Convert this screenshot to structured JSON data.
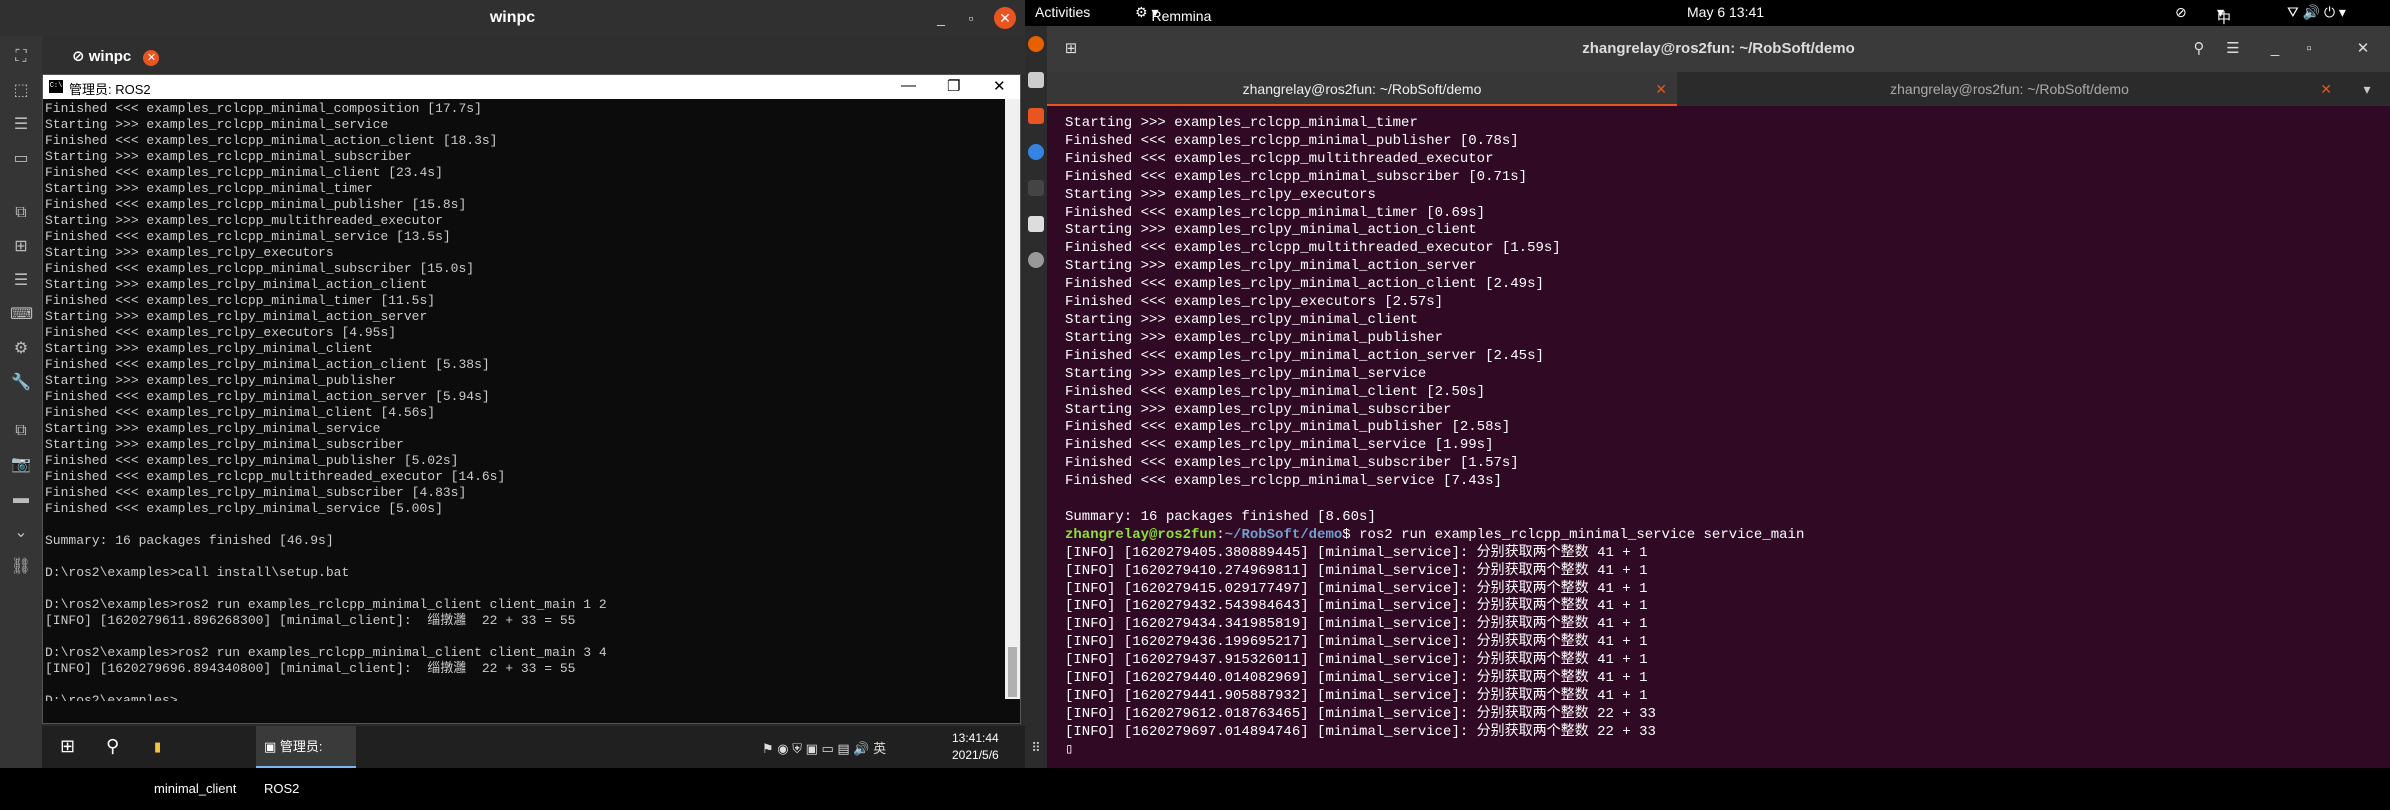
{
  "remmina": {
    "title": "winpc",
    "tab_label": "winpc",
    "tab_close": "✕"
  },
  "cmd": {
    "title": "管理员: ROS2",
    "icon_text": "C:\\",
    "lines": [
      "Finished <<< examples_rclcpp_minimal_composition [17.7s]",
      "Starting >>> examples_rclcpp_minimal_service",
      "Finished <<< examples_rclcpp_minimal_action_client [18.3s]",
      "Starting >>> examples_rclcpp_minimal_subscriber",
      "Finished <<< examples_rclcpp_minimal_client [23.4s]",
      "Starting >>> examples_rclcpp_minimal_timer",
      "Finished <<< examples_rclcpp_minimal_publisher [15.8s]",
      "Starting >>> examples_rclcpp_multithreaded_executor",
      "Finished <<< examples_rclcpp_minimal_service [13.5s]",
      "Starting >>> examples_rclpy_executors",
      "Finished <<< examples_rclcpp_minimal_subscriber [15.0s]",
      "Starting >>> examples_rclpy_minimal_action_client",
      "Finished <<< examples_rclcpp_minimal_timer [11.5s]",
      "Starting >>> examples_rclpy_minimal_action_server",
      "Finished <<< examples_rclpy_executors [4.95s]",
      "Starting >>> examples_rclpy_minimal_client",
      "Finished <<< examples_rclpy_minimal_action_client [5.38s]",
      "Starting >>> examples_rclpy_minimal_publisher",
      "Finished <<< examples_rclpy_minimal_action_server [5.94s]",
      "Finished <<< examples_rclpy_minimal_client [4.56s]",
      "Starting >>> examples_rclpy_minimal_service",
      "Starting >>> examples_rclpy_minimal_subscriber",
      "Finished <<< examples_rclpy_minimal_publisher [5.02s]",
      "Finished <<< examples_rclcpp_multithreaded_executor [14.6s]",
      "Finished <<< examples_rclpy_minimal_subscriber [4.83s]",
      "Finished <<< examples_rclpy_minimal_service [5.00s]",
      "",
      "Summary: 16 packages finished [46.9s]",
      "",
      "D:\\ros2\\examples>call install\\setup.bat",
      "",
      "D:\\ros2\\examples>ros2 run examples_rclcpp_minimal_client client_main 1 2",
      "[INFO] [1620279611.896268300] [minimal_client]:  缁撴灉  22 + 33 = 55",
      "",
      "D:\\ros2\\examples>ros2 run examples_rclcpp_minimal_client client_main 3 4",
      "[INFO] [1620279696.894340800] [minimal_client]:  缁撴灉  22 + 33 = 55",
      "",
      "D:\\ros2\\examples>_"
    ]
  },
  "taskbar": {
    "apps": [
      "minimal_client",
      "管理员: ROS2"
    ],
    "tray_lang": "英",
    "time": "13:41:44",
    "date": "2021/5/6"
  },
  "ubuntu_topbar": {
    "activities": "Activities",
    "app_menu": "Remmina",
    "clock": "May 6  13:41",
    "input_method": "中"
  },
  "terminal": {
    "title": "zhangrelay@ros2fun: ~/RobSoft/demo",
    "tabs": [
      "zhangrelay@ros2fun: ~/RobSoft/demo",
      "zhangrelay@ros2fun: ~/RobSoft/demo"
    ],
    "lines_before": [
      "Starting >>> examples_rclcpp_minimal_timer",
      "Finished <<< examples_rclcpp_minimal_publisher [0.78s]",
      "Finished <<< examples_rclcpp_multithreaded_executor",
      "Finished <<< examples_rclcpp_minimal_subscriber [0.71s]",
      "Starting >>> examples_rclpy_executors",
      "Finished <<< examples_rclcpp_minimal_timer [0.69s]",
      "Starting >>> examples_rclpy_minimal_action_client",
      "Finished <<< examples_rclcpp_multithreaded_executor [1.59s]",
      "Starting >>> examples_rclpy_minimal_action_server",
      "Finished <<< examples_rclpy_minimal_action_client [2.49s]",
      "Finished <<< examples_rclpy_executors [2.57s]",
      "Starting >>> examples_rclpy_minimal_client",
      "Starting >>> examples_rclpy_minimal_publisher",
      "Finished <<< examples_rclpy_minimal_action_server [2.45s]",
      "Starting >>> examples_rclpy_minimal_service",
      "Finished <<< examples_rclpy_minimal_client [2.50s]",
      "Starting >>> examples_rclpy_minimal_subscriber",
      "Finished <<< examples_rclpy_minimal_publisher [2.58s]",
      "Finished <<< examples_rclpy_minimal_service [1.99s]",
      "Finished <<< examples_rclpy_minimal_subscriber [1.57s]",
      "Finished <<< examples_rclcpp_minimal_service [7.43s]",
      "",
      "Summary: 16 packages finished [8.60s]"
    ],
    "prompt_user": "zhangrelay@ros2fun",
    "prompt_sep": ":",
    "prompt_path": "~/RobSoft/demo",
    "prompt_cmd": "$ ros2 run examples_rclcpp_minimal_service service_main",
    "lines_after": [
      "[INFO] [1620279405.380889445] [minimal_service]: 分别获取两个整数 41 + 1",
      "[INFO] [1620279410.274969811] [minimal_service]: 分别获取两个整数 41 + 1",
      "[INFO] [1620279415.029177497] [minimal_service]: 分别获取两个整数 41 + 1",
      "[INFO] [1620279432.543984643] [minimal_service]: 分别获取两个整数 41 + 1",
      "[INFO] [1620279434.341985819] [minimal_service]: 分别获取两个整数 41 + 1",
      "[INFO] [1620279436.199695217] [minimal_service]: 分别获取两个整数 41 + 1",
      "[INFO] [1620279437.915326011] [minimal_service]: 分别获取两个整数 41 + 1",
      "[INFO] [1620279440.014082969] [minimal_service]: 分别获取两个整数 41 + 1",
      "[INFO] [1620279441.905887932] [minimal_service]: 分别获取两个整数 41 + 1",
      "[INFO] [1620279612.018763465] [minimal_service]: 分别获取两个整数 22 + 33",
      "[INFO] [1620279697.014894746] [minimal_service]: 分别获取两个整数 22 + 33"
    ]
  },
  "colors": {
    "ubuntu_accent": "#e95420",
    "terminal_bg": "#300a24",
    "prompt_user": "#8ae234",
    "prompt_path": "#729fcf"
  }
}
